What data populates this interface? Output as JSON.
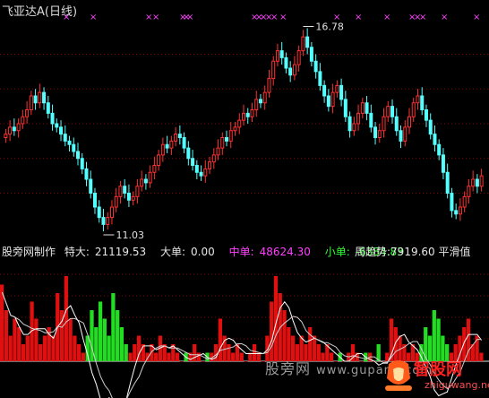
{
  "header": {
    "stock_name": "飞亚达A",
    "period": "(日线)"
  },
  "price_chart": {
    "high_label": "16.78",
    "low_label": "11.03"
  },
  "indicator": {
    "source": "股旁网制作",
    "special_label": "特大:",
    "special_value": "21119.53",
    "big_label": "大单:",
    "big_value": "0.00",
    "mid_label": "中单:",
    "mid_value": "48624.30",
    "small_label": "小单:",
    "small_value": "-6384.83",
    "weekly_label": "周趋势:",
    "weekly_value": "7919.60",
    "smooth_label": "平滑值"
  },
  "watermark": {
    "site": "股旁网",
    "url": "www.gupang.com"
  },
  "logo": {
    "text": "智股网",
    "url": "zhiguwang.net"
  },
  "colors": {
    "background": "#000000",
    "up_candle": "#ff3232",
    "down_candle": "#54ffff",
    "signal_mark": "#ff40ff",
    "positive_bar": "#e01010",
    "negative_bar": "#22dd22",
    "line": "#ffffff",
    "grid": "#8b0000"
  },
  "chart_data": [
    {
      "type": "candlestick",
      "title": "飞亚达A (日线)",
      "annotations": [
        {
          "text": "16.78",
          "kind": "high",
          "value": 16.78
        },
        {
          "text": "11.03",
          "kind": "low",
          "value": 11.03
        }
      ],
      "y_range": [
        10.8,
        17.2
      ],
      "close": [
        13.7,
        13.9,
        13.8,
        14.0,
        14.2,
        14.4,
        14.8,
        14.6,
        14.9,
        14.6,
        14.3,
        14.0,
        13.9,
        13.7,
        13.5,
        13.4,
        13.2,
        13.0,
        12.7,
        12.4,
        12.0,
        11.6,
        11.3,
        11.1,
        11.3,
        11.6,
        11.9,
        12.2,
        12.0,
        11.8,
        11.9,
        12.2,
        12.4,
        12.3,
        12.6,
        12.8,
        13.1,
        13.4,
        13.3,
        13.5,
        13.7,
        13.6,
        13.3,
        13.0,
        12.8,
        12.6,
        12.5,
        12.7,
        12.9,
        13.1,
        13.3,
        13.6,
        13.5,
        13.8,
        13.9,
        14.1,
        14.3,
        14.2,
        14.4,
        14.7,
        14.6,
        14.9,
        15.3,
        15.8,
        16.1,
        15.9,
        15.6,
        15.4,
        15.7,
        16.1,
        16.5,
        16.2,
        15.8,
        15.5,
        15.1,
        14.8,
        14.5,
        14.9,
        15.1,
        14.7,
        14.2,
        13.8,
        14.0,
        14.3,
        14.6,
        14.3,
        13.9,
        13.6,
        13.8,
        14.2,
        14.5,
        14.2,
        13.8,
        13.5,
        13.9,
        14.2,
        14.6,
        14.8,
        14.4,
        14.1,
        13.7,
        13.4,
        13.1,
        12.6,
        12.0,
        11.5,
        11.4,
        11.6,
        11.9,
        12.2,
        12.4,
        12.2,
        12.5
      ]
    },
    {
      "type": "bar",
      "title": "",
      "series": [
        {
          "values": [
            0.9,
            0.6,
            0.3,
            0.5,
            0.4,
            0.2,
            0.3,
            0.7,
            0.5,
            0.2,
            0.3,
            0.4,
            0.3,
            0.8,
            0.6,
            1.0,
            0.5,
            0.3,
            0.2,
            0.1,
            -0.3,
            -0.6,
            -0.4,
            -0.7,
            -0.5,
            -0.3,
            -0.8,
            -0.6,
            -0.4,
            -0.2,
            0.1,
            0.2,
            0.3,
            0.2,
            0.1,
            0.2,
            0.1,
            0.3,
            0.2,
            0.1,
            0.2,
            0.1,
            0.0,
            -0.1,
            0.1,
            0.2,
            0.1,
            0.0,
            -0.1,
            0.1,
            0.2,
            0.5,
            0.3,
            0.2,
            0.1,
            0.2,
            0.1,
            0.0,
            0.1,
            0.2,
            0.1,
            0.0,
            0.3,
            0.7,
            1.0,
            0.8,
            0.6,
            0.4,
            0.3,
            0.2,
            0.3,
            0.2,
            0.4,
            0.3,
            0.2,
            0.1,
            0.2,
            0.1,
            0.0,
            -0.1,
            0.0,
            0.1,
            0.2,
            0.1,
            0.0,
            -0.1,
            0.1,
            0.0,
            -0.2,
            0.0,
            0.1,
            0.5,
            0.4,
            0.3,
            0.2,
            0.1,
            0.2,
            0.1,
            -0.2,
            -0.4,
            -0.3,
            -0.6,
            -0.5,
            -0.3,
            -0.2,
            0.1,
            0.2,
            0.3,
            0.4,
            0.5,
            0.2,
            0.3,
            0.1
          ]
        }
      ]
    }
  ]
}
